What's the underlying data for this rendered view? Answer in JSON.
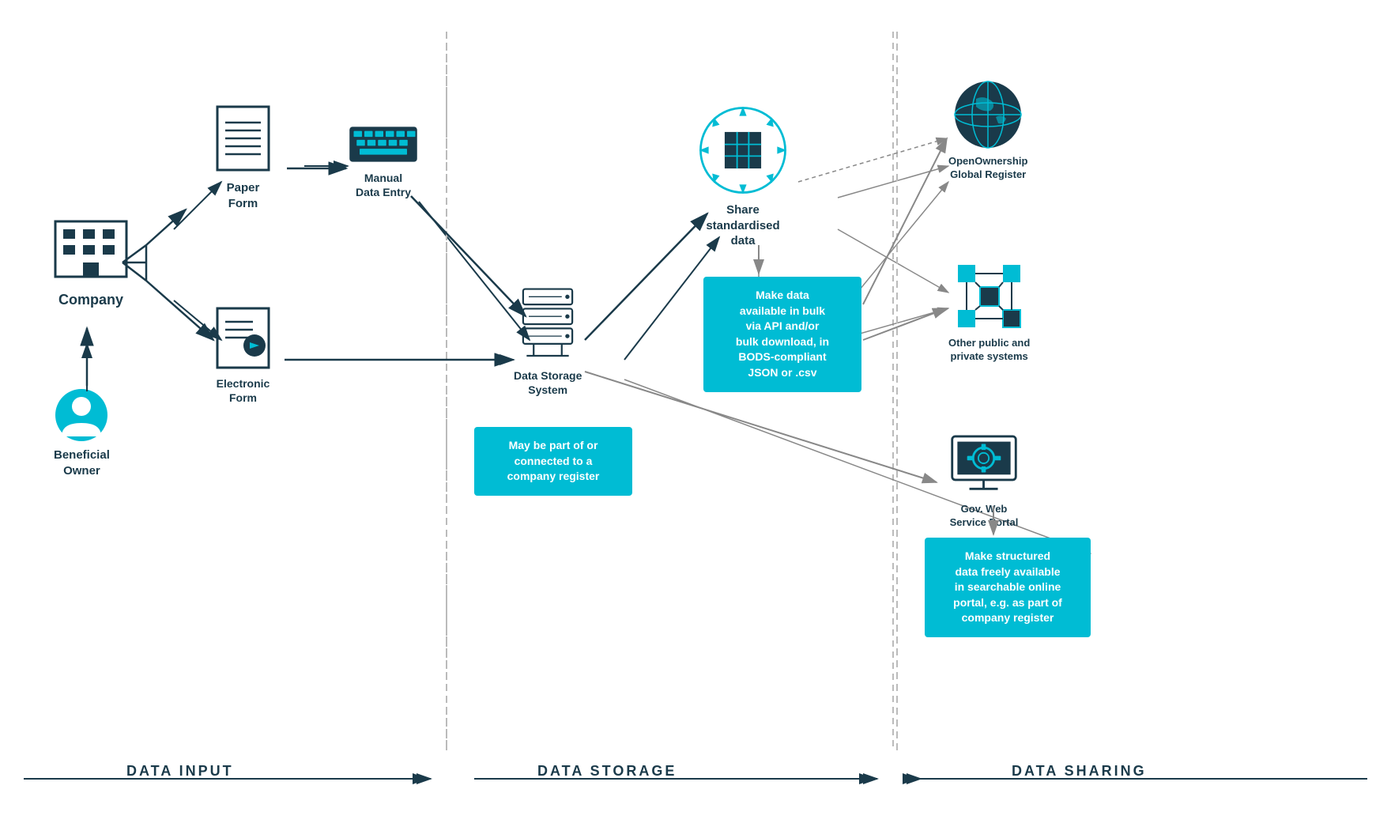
{
  "sections": {
    "data_input": "DATA INPUT",
    "data_storage": "DATA STORAGE",
    "data_sharing": "DATA SHARING"
  },
  "nodes": {
    "company": {
      "label": "Company"
    },
    "beneficial_owner": {
      "label": "Beneficial\nOwner"
    },
    "paper_form": {
      "label": "Paper\nForm"
    },
    "manual_data_entry": {
      "label": "Manual\nData Entry"
    },
    "electronic_form": {
      "label": "Electronic\nForm"
    },
    "data_storage_system": {
      "label": "Data Storage\nSystem"
    },
    "share_standardised": {
      "label": "Share\nstandardised\ndata"
    },
    "openownership": {
      "label": "OpenOwnership\nGlobal Register"
    },
    "other_systems": {
      "label": "Other public and\nprivate systems"
    },
    "gov_portal": {
      "label": "Gov. Web\nService Portal"
    }
  },
  "cyan_boxes": {
    "company_register": "May be part of or\nconnected to a\ncompany register",
    "bulk_api": "Make data\navailable in bulk\nvia API and/or\nbulk download, in\nBODS-compliant\nJSON or .csv",
    "searchable_portal": "Make structured\ndata freely available\nin searchable online\nportal, e.g. as part of\ncompany register"
  },
  "colors": {
    "cyan": "#00bcd4",
    "dark_blue": "#1a3a4a",
    "arrow": "#1a3a4a",
    "divider": "#aaaaaa"
  }
}
